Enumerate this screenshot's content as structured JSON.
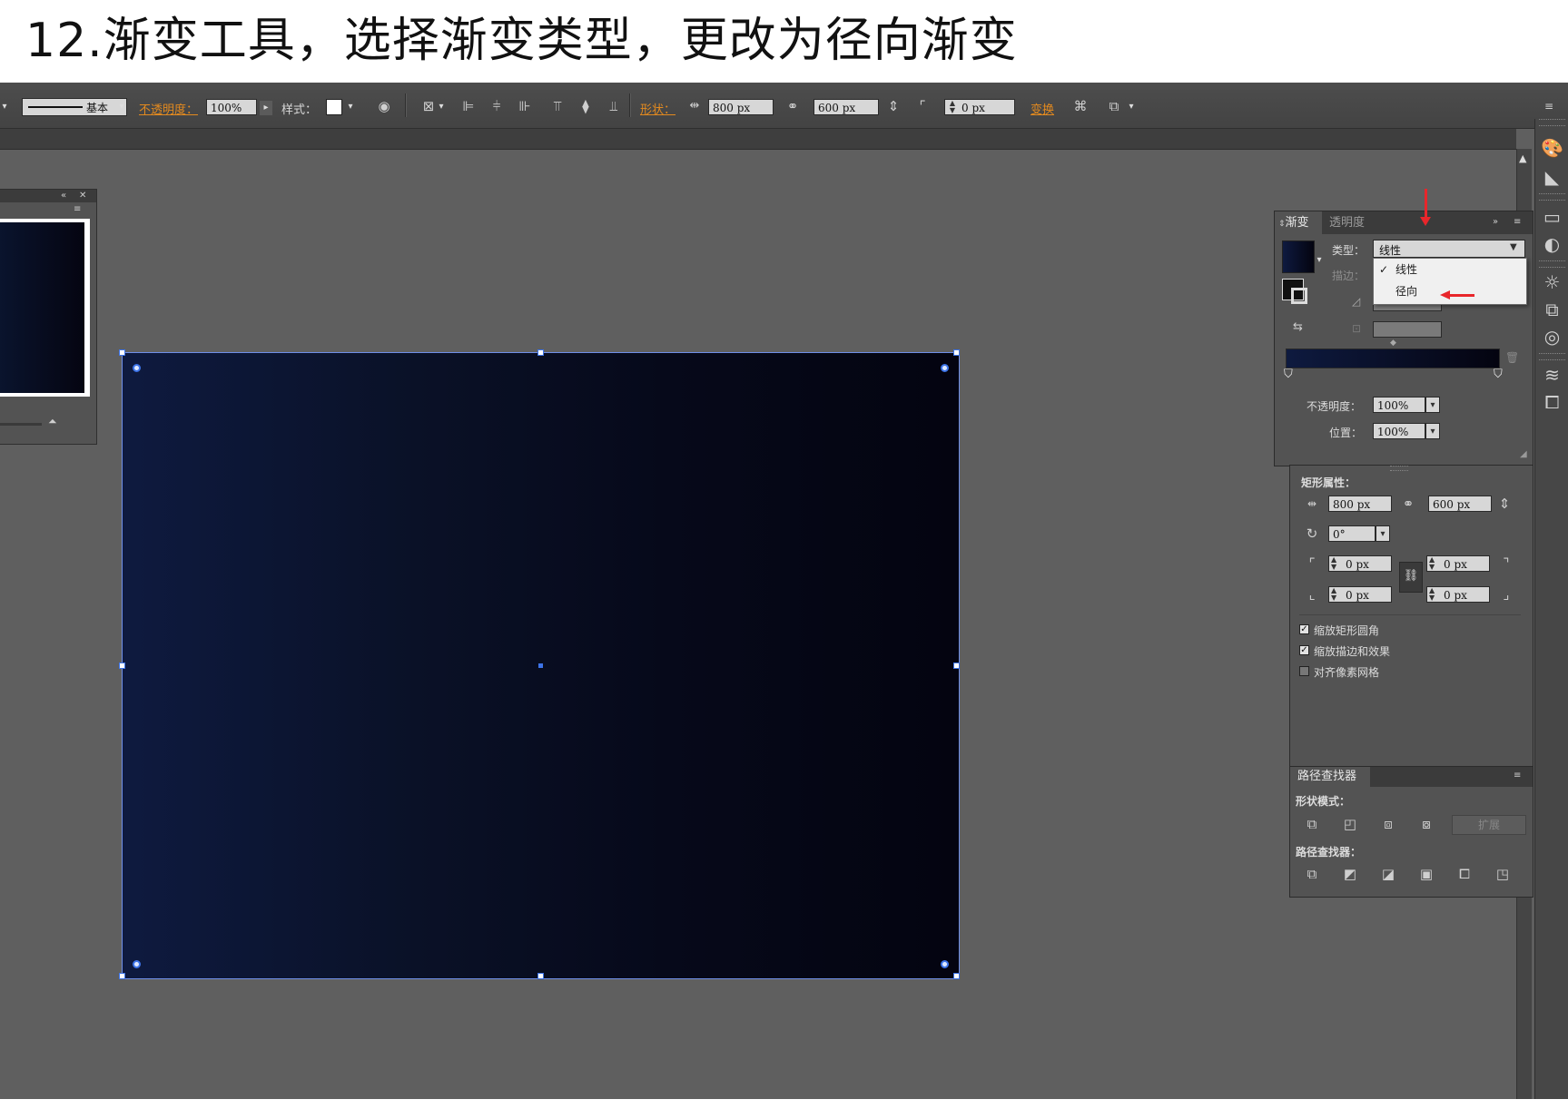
{
  "page_title": "12.渐变工具，选择渐变类型，更改为径向渐变",
  "control_bar": {
    "stroke_style": "基本",
    "opacity_label": "不透明度：",
    "opacity_value": "100%",
    "style_label": "样式：",
    "shape_label": "形状：",
    "width_value": "800 px",
    "height_value": "600 px",
    "corner_value": "0 px",
    "transform_label": "变换"
  },
  "gradient_panel": {
    "tab_gradient": "渐变",
    "tab_transparency": "透明度",
    "type_label": "类型：",
    "type_value": "线性",
    "stroke_label": "描边：",
    "menu_options": [
      "线性",
      "径向"
    ],
    "opacity_label": "不透明度：",
    "opacity_value": "100%",
    "location_label": "位置：",
    "location_value": "100%",
    "colors": {
      "stop_start": "#0e1a3f",
      "stop_end": "#040410"
    }
  },
  "rect_panel": {
    "title": "矩形属性：",
    "width_value": "800 px",
    "height_value": "600 px",
    "rotation_value": "0°",
    "corner_tl": "0 px",
    "corner_tr": "0 px",
    "corner_bl": "0 px",
    "corner_br": "0 px",
    "checkbox_scale_corners": "缩放矩形圆角",
    "checkbox_scale_strokes": "缩放描边和效果",
    "checkbox_align_pixel": "对齐像素网格"
  },
  "pathfinder_panel": {
    "title": "路径查找器",
    "shape_modes_label": "形状模式：",
    "expand_button": "扩展",
    "pathfinders_label": "路径查找器："
  },
  "colors": {
    "accent_selection": "#3d74e8",
    "annotation_red": "#e8262b",
    "highlight_orange": "#e38a1f"
  }
}
